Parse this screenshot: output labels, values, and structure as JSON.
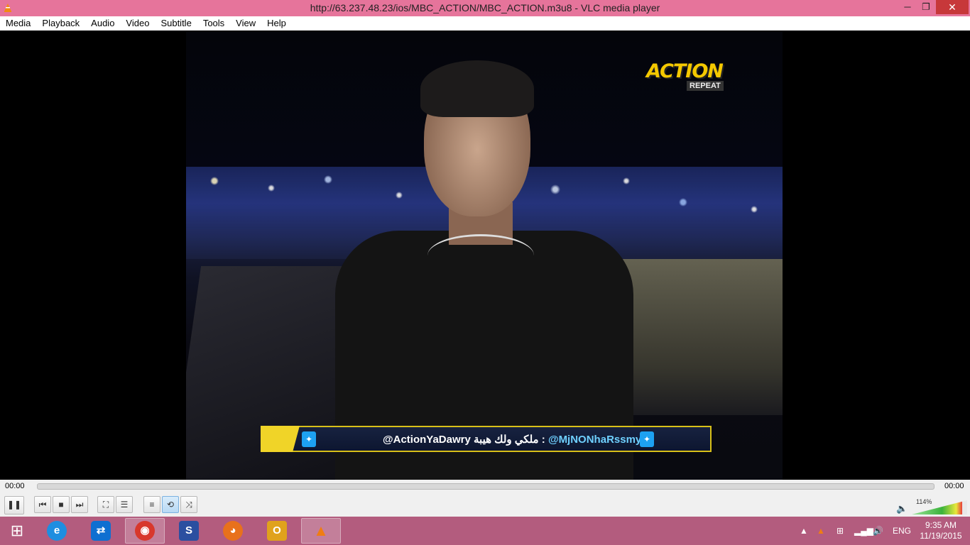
{
  "window": {
    "title": "http://63.237.48.23/ios/MBC_ACTION/MBC_ACTION.m3u8 - VLC media player",
    "app_icon": "vlc-cone-icon",
    "buttons": {
      "minimize": "─",
      "maximize": "❐",
      "close": "✕"
    }
  },
  "menu": [
    "Media",
    "Playback",
    "Audio",
    "Video",
    "Subtitle",
    "Tools",
    "View",
    "Help"
  ],
  "video": {
    "channel_logo": {
      "main": "ACTION",
      "badge": "REPEAT"
    },
    "ticker": {
      "handle": "@MjNONhaRssmy",
      "separator": " : ",
      "message": "@ActionYaDawry ملكي ولك هيبة"
    }
  },
  "player": {
    "time_elapsed": "00:00",
    "time_total": "00:00",
    "seek_position": 0,
    "volume_percent": 114,
    "volume_label": "114%",
    "controls": [
      {
        "name": "pause-button",
        "icon": "pause-icon",
        "glyph": "❚❚"
      },
      {
        "name": "previous-button",
        "icon": "previous-icon",
        "glyph": "⏮"
      },
      {
        "name": "stop-button",
        "icon": "stop-icon",
        "glyph": "■"
      },
      {
        "name": "next-button",
        "icon": "next-icon",
        "glyph": "⏭"
      },
      {
        "name": "fullscreen-button",
        "icon": "fullscreen-icon",
        "glyph": "⛶"
      },
      {
        "name": "extended-settings-button",
        "icon": "equalizer-icon",
        "glyph": "☰"
      },
      {
        "name": "playlist-button",
        "icon": "playlist-icon",
        "glyph": "≡"
      },
      {
        "name": "loop-button",
        "icon": "loop-icon",
        "glyph": "⟲"
      },
      {
        "name": "shuffle-button",
        "icon": "shuffle-icon",
        "glyph": "⤨"
      }
    ]
  },
  "taskbar": {
    "start_icon": "windows-start-icon",
    "apps": [
      {
        "name": "internet-explorer",
        "icon": "internet-explorer-icon",
        "glyph": "e",
        "color": "#1e8ee0",
        "active": false
      },
      {
        "name": "teamviewer",
        "icon": "teamviewer-icon",
        "glyph": "⇄",
        "color": "#0e6fd1",
        "active": false
      },
      {
        "name": "chrome",
        "icon": "chrome-icon",
        "glyph": "◉",
        "color": "#d8382c",
        "active": true
      },
      {
        "name": "scheduler",
        "icon": "scheduler-icon",
        "glyph": "S",
        "color": "#2b4fa0",
        "active": false
      },
      {
        "name": "firefox",
        "icon": "firefox-icon",
        "glyph": "◕",
        "color": "#e8711c",
        "active": false
      },
      {
        "name": "outlook",
        "icon": "outlook-icon",
        "glyph": "O",
        "color": "#e0a21c",
        "active": false
      },
      {
        "name": "vlc",
        "icon": "vlc-cone-icon",
        "glyph": "▲",
        "color": "#f07d12",
        "active": true
      }
    ],
    "tray": {
      "language": "ENG",
      "time": "9:35 AM",
      "date": "11/19/2015"
    }
  }
}
